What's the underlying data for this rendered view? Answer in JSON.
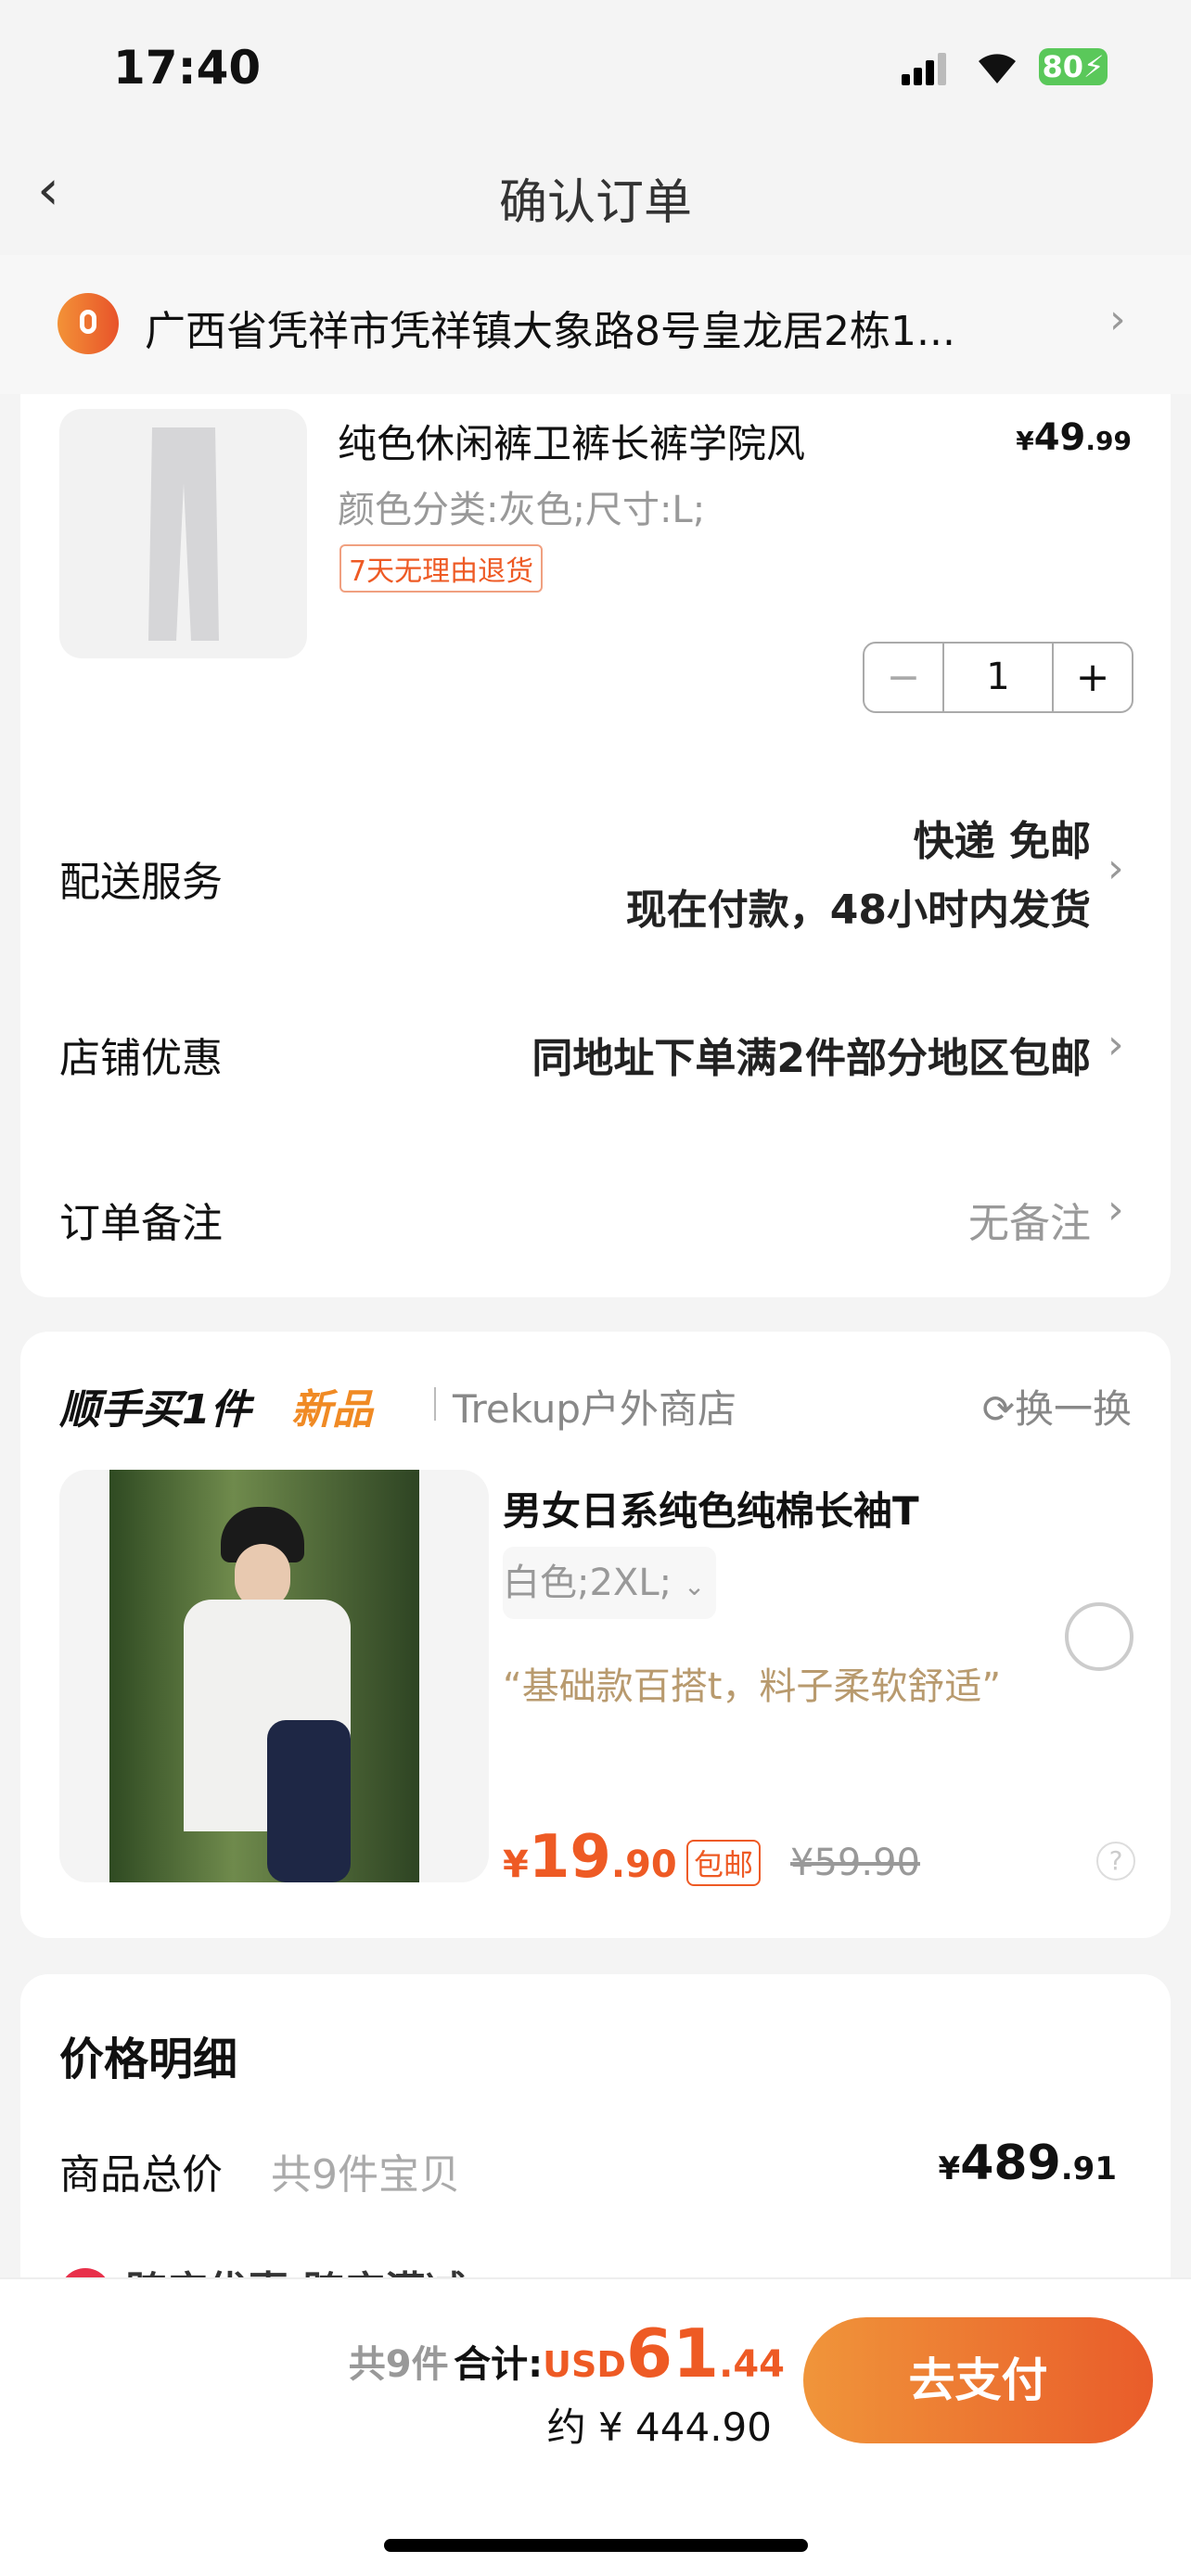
{
  "status": {
    "time": "17:40",
    "battery": "80"
  },
  "nav": {
    "title": "确认订单"
  },
  "address": {
    "text": "广西省凭祥市凭祥镇大象路8号皇龙居2栋1..."
  },
  "item": {
    "title": "纯色休闲裤卫裤长裤学院风",
    "spec": "颜色分类:灰色;尺寸:L;",
    "tag": "7天无理由退货",
    "price_sym": "¥",
    "price_int": "49",
    "price_dec": ".99",
    "qty": "1",
    "minus": "−",
    "plus": "+"
  },
  "rows": {
    "delivery": {
      "label": "配送服务",
      "line1": "快递 免邮",
      "line2": "现在付款，48小时内发货"
    },
    "promo": {
      "label": "店铺优惠",
      "value": "同地址下单满2件部分地区包邮"
    },
    "note": {
      "label": "订单备注",
      "value": "无备注"
    }
  },
  "addon": {
    "title": "顺手买1件",
    "badge": "新品",
    "shop": "Trekup户外商店",
    "swap": "换一换",
    "item_title": "男女日系纯色纯棉长袖T",
    "spec": "白色;2XL;",
    "quote": "“基础款百搭t，料子柔软舒适”",
    "price_sym": "¥",
    "price_int": "19",
    "price_dec": ".90",
    "free_ship": "包邮",
    "orig_price": "¥59.90"
  },
  "detail": {
    "title": "价格明细",
    "total_label": "商品总价",
    "total_count": "共9件宝贝",
    "total_sym": "¥",
    "total_int": "489",
    "total_dec": ".91",
    "partial": "跨店优惠 跨店满减"
  },
  "footer": {
    "count": "共9件",
    "sum_label": "合计:",
    "currency": "USD",
    "amount_int": "61",
    "amount_dec": ".44",
    "approx": "约 ¥ 444.90",
    "pay": "去支付"
  },
  "colors": {
    "accent": "#ee5a24",
    "gold": "#b89a6e"
  }
}
